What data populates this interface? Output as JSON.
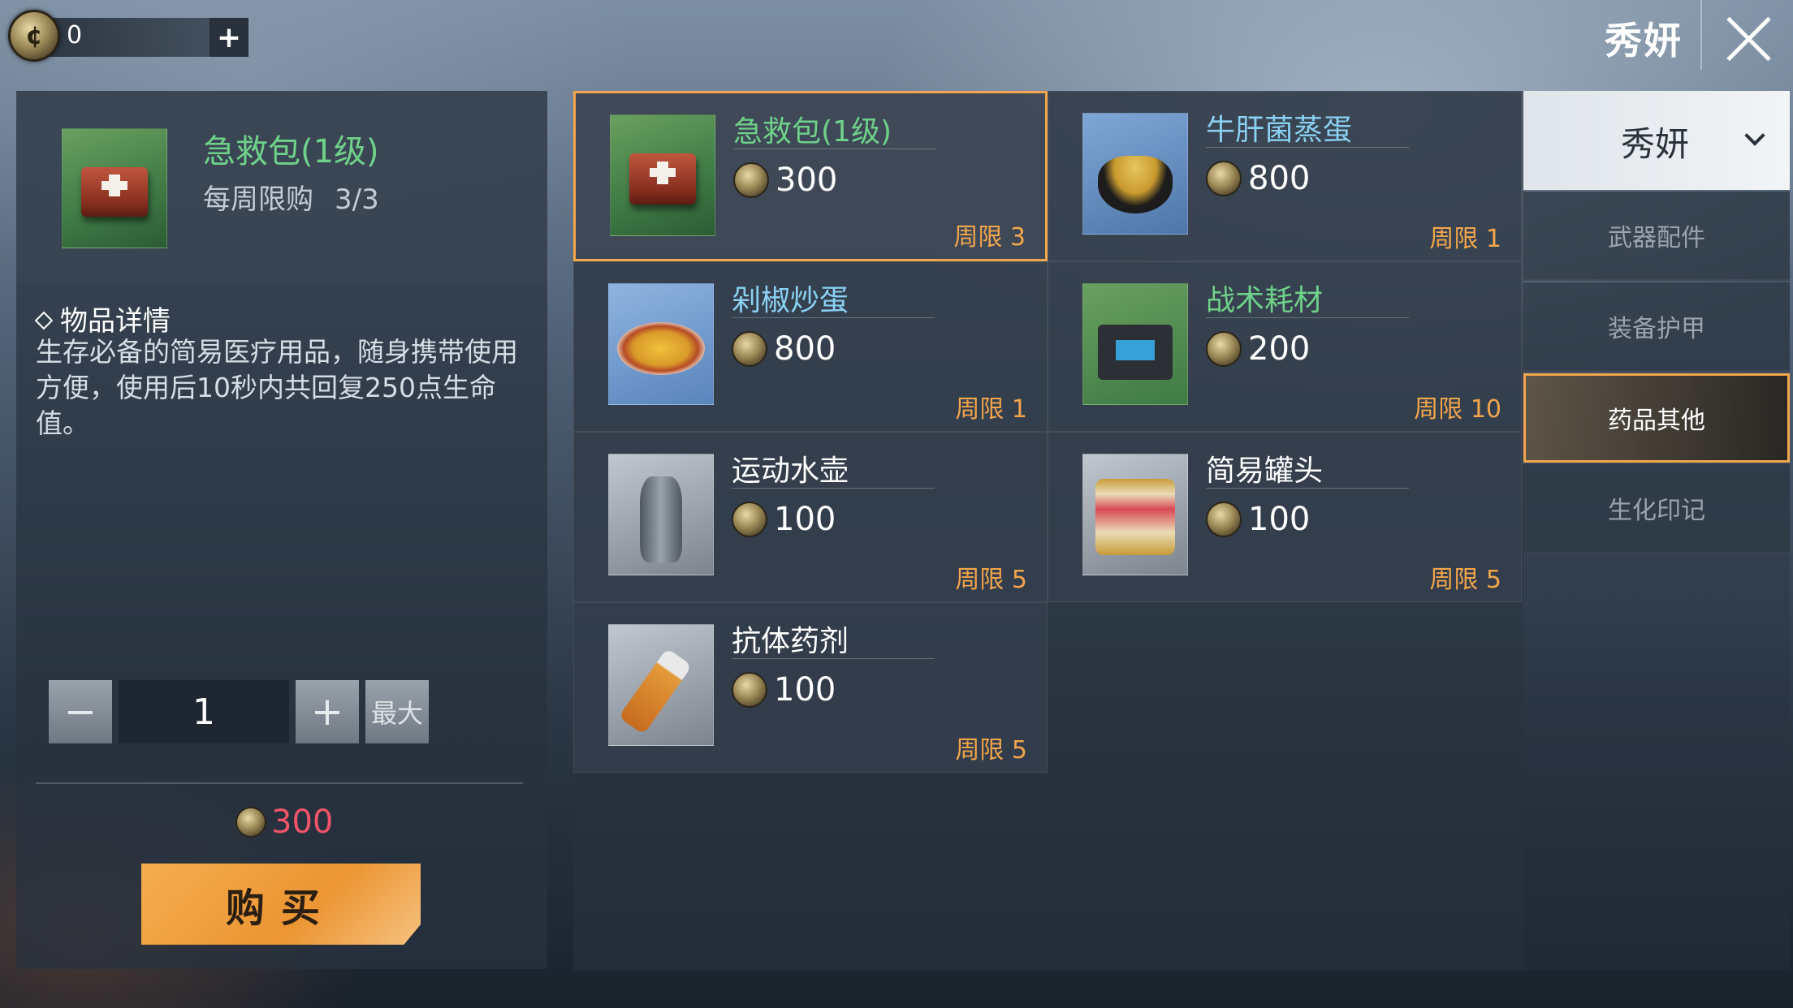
{
  "topbar": {
    "currency_amount": "0",
    "player_name": "秀妍"
  },
  "detail": {
    "item_name": "急救包(1级)",
    "weekly_limit_label": "每周限购",
    "weekly_limit_value": "3/3",
    "section_title": "物品详情",
    "description": "生存必备的简易医疗用品，随身携带使用方便，使用后10秒内共回复250点生命值。",
    "quantity": "1",
    "max_label": "最大",
    "total_price": "300",
    "buy_label": "购买"
  },
  "items": [
    {
      "name": "急救包(1级)",
      "price": "300",
      "limit": "周限 3",
      "selected": true,
      "thumb": "medkit"
    },
    {
      "name": "牛肝菌蒸蛋",
      "price": "800",
      "limit": "周限 1",
      "selected": false,
      "thumb": "bowl"
    },
    {
      "name": "剁椒炒蛋",
      "price": "800",
      "limit": "周限 1",
      "selected": false,
      "thumb": "plate"
    },
    {
      "name": "战术耗材",
      "price": "200",
      "limit": "周限 10",
      "selected": false,
      "thumb": "battery"
    },
    {
      "name": "运动水壶",
      "price": "100",
      "limit": "周限 5",
      "selected": false,
      "thumb": "flask"
    },
    {
      "name": "简易罐头",
      "price": "100",
      "limit": "周限 5",
      "selected": false,
      "thumb": "can"
    },
    {
      "name": "抗体药剂",
      "price": "100",
      "limit": "周限 5",
      "selected": false,
      "thumb": "pill"
    }
  ],
  "tabs": {
    "dropdown_label": "秀妍",
    "list": [
      "武器配件",
      "装备护甲",
      "药品其他",
      "生化印记"
    ],
    "active_index": 2
  },
  "colors": {
    "accent": "#f3a64b",
    "name_green": "#6fd18a",
    "name_blue": "#8ad1f3",
    "price_red": "#f1546a"
  }
}
